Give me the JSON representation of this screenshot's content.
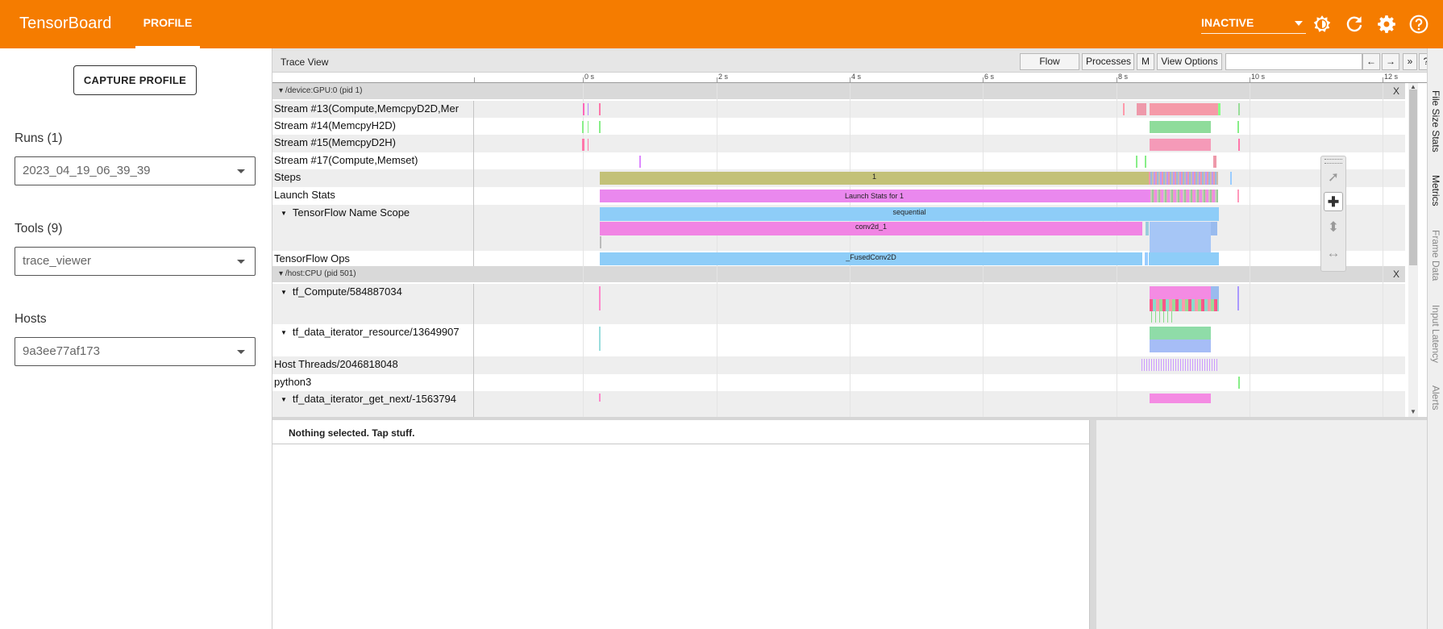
{
  "header": {
    "brand": "TensorBoard",
    "active_tab": "PROFILE",
    "status": "INACTIVE",
    "accent": "#f57c00",
    "icons": [
      "theme-icon",
      "refresh-icon",
      "settings-icon",
      "help-icon"
    ]
  },
  "sidebar": {
    "capture_label": "CAPTURE PROFILE",
    "runs_label": "Runs (1)",
    "runs_value": "2023_04_19_06_39_39",
    "tools_label": "Tools (9)",
    "tools_value": "trace_viewer",
    "hosts_label": "Hosts",
    "hosts_value": "9a3ee77af173"
  },
  "trace": {
    "title": "Trace View",
    "buttons": {
      "flow": "Flow events",
      "processes": "Processes",
      "m": "M",
      "view_options": "View Options"
    },
    "nav": {
      "prev": "←",
      "next": "→",
      "more": "»",
      "help": "?"
    },
    "ticks": [
      "0 s",
      "2 s",
      "4 s",
      "6 s",
      "8 s",
      "10 s",
      "12 s"
    ],
    "groups": {
      "gpu": "/device:GPU:0 (pid 1)",
      "cpu": "/host:CPU (pid 501)",
      "close": "X"
    },
    "rows": {
      "s13": "Stream #13(Compute,MemcpyD2D,Mer",
      "s14": "Stream #14(MemcpyH2D)",
      "s15": "Stream #15(MemcpyD2H)",
      "s17": "Stream #17(Compute,Memset)",
      "steps": "Steps",
      "launch": "Launch Stats",
      "tfscope": "TensorFlow Name Scope",
      "tfops": "TensorFlow Ops",
      "tfcompute": "tf_Compute/584887034",
      "tfdata": "tf_data_iterator_resource/13649907",
      "hostthreads": "Host Threads/2046818048",
      "python": "python3",
      "getnext": "tf_data_iterator_get_next/-1563794"
    },
    "slices": {
      "step": "1",
      "launch": "Launch Stats for 1",
      "sequential": "sequential",
      "conv": "conv2d_1",
      "fused": "_FusedConv2D"
    }
  },
  "side_tabs": [
    "File Size Stats",
    "Metrics",
    "Frame Data",
    "Input Latency",
    "Alerts"
  ],
  "details": {
    "message": "Nothing selected. Tap stuff."
  }
}
